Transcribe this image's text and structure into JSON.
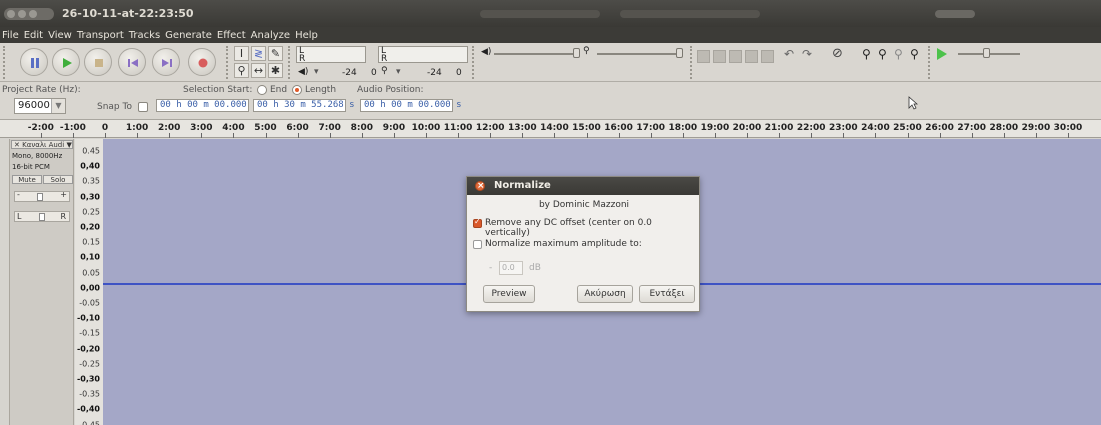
{
  "window": {
    "title": "26-10-11-at-22:23:50"
  },
  "menu": [
    "File",
    "Edit",
    "View",
    "Transport",
    "Tracks",
    "Generate",
    "Effect",
    "Analyze",
    "Help"
  ],
  "toolbar": {
    "meter_left_label": "L",
    "meter_right_label": "R",
    "meter_scale_1": "-24",
    "meter_scale_2": "0",
    "meter_scale_3": "-24",
    "meter_scale_4": "0"
  },
  "selection": {
    "project_rate_label": "Project Rate (Hz):",
    "project_rate_value": "96000",
    "selection_start_label": "Selection Start:",
    "end_label": "End",
    "length_label": "Length",
    "audio_position_label": "Audio Position:",
    "snap_to_label": "Snap To",
    "start_value": "00 h 00 m 00.000 s",
    "length_value": "00 h 30 m 55.268 s",
    "audio_position_value": "00 h 00 m 00.000 s"
  },
  "ruler": {
    "ticks": [
      "-2:00",
      "-1:00",
      "0",
      "1:00",
      "2:00",
      "3:00",
      "4:00",
      "5:00",
      "6:00",
      "7:00",
      "8:00",
      "9:00",
      "10:00",
      "11:00",
      "12:00",
      "13:00",
      "14:00",
      "15:00",
      "16:00",
      "17:00",
      "18:00",
      "19:00",
      "20:00",
      "21:00",
      "22:00",
      "23:00",
      "24:00",
      "25:00",
      "26:00",
      "27:00",
      "28:00",
      "29:00",
      "30:00"
    ]
  },
  "track": {
    "name": "Καναλι Audi",
    "format_line": "Mono, 8000Hz",
    "bitdepth_line": "16-bit PCM",
    "mute_label": "Mute",
    "solo_label": "Solo",
    "pan_left": "L",
    "pan_right": "R"
  },
  "vscale": [
    "0.45",
    "0,40",
    "0.35",
    "0,30",
    "0.25",
    "0,20",
    "0.15",
    "0,10",
    "0.05",
    "0,00",
    "-0.05",
    "-0,10",
    "-0.15",
    "-0,20",
    "-0.25",
    "-0,30",
    "-0.35",
    "-0,40",
    "-0.45"
  ],
  "dialog": {
    "title": "Normalize",
    "author": "by Dominic Mazzoni",
    "remove_dc_label": "Remove any DC offset (center on 0.0 vertically)",
    "remove_dc_checked": true,
    "normalize_label": "Normalize maximum amplitude to:",
    "normalize_checked": false,
    "amplitude_prefix": "-",
    "amplitude_value": "0.0",
    "amplitude_unit": "dB",
    "preview_label": "Preview",
    "cancel_label": "Ακύρωση",
    "ok_label": "Εντάξει"
  },
  "colors": {
    "waveform_bg": "#a4a7c7",
    "waveform_line": "#3e53c4",
    "accent": "#d9582b"
  }
}
